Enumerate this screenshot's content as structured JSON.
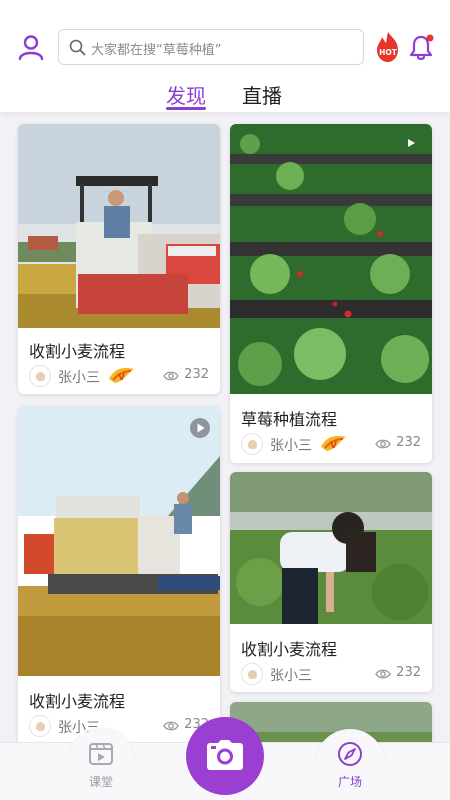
{
  "header": {
    "search_placeholder": "大家都在搜“草莓种植”",
    "hot_badge": "HOT"
  },
  "tabs": [
    {
      "label": "发现",
      "active": true
    },
    {
      "label": "直播",
      "active": false
    }
  ],
  "colors": {
    "accent": "#8a3fd0",
    "camera": "#9b3fd2"
  },
  "feed": {
    "cards": [
      {
        "title": "收割小麦流程",
        "author": "张小三",
        "views": "232",
        "vip": true,
        "video": false
      },
      {
        "title": "草莓种植流程",
        "author": "张小三",
        "views": "232",
        "vip": true,
        "video": true
      },
      {
        "title": "收割小麦流程",
        "author": "张小三",
        "views": "232",
        "vip": false,
        "video": true
      },
      {
        "title": "收割小麦流程",
        "author": "张小三",
        "views": "232",
        "vip": false,
        "video": false
      }
    ]
  },
  "bottom_nav": {
    "classroom": "课堂",
    "square": "广场",
    "camera_icon": "camera-icon"
  }
}
